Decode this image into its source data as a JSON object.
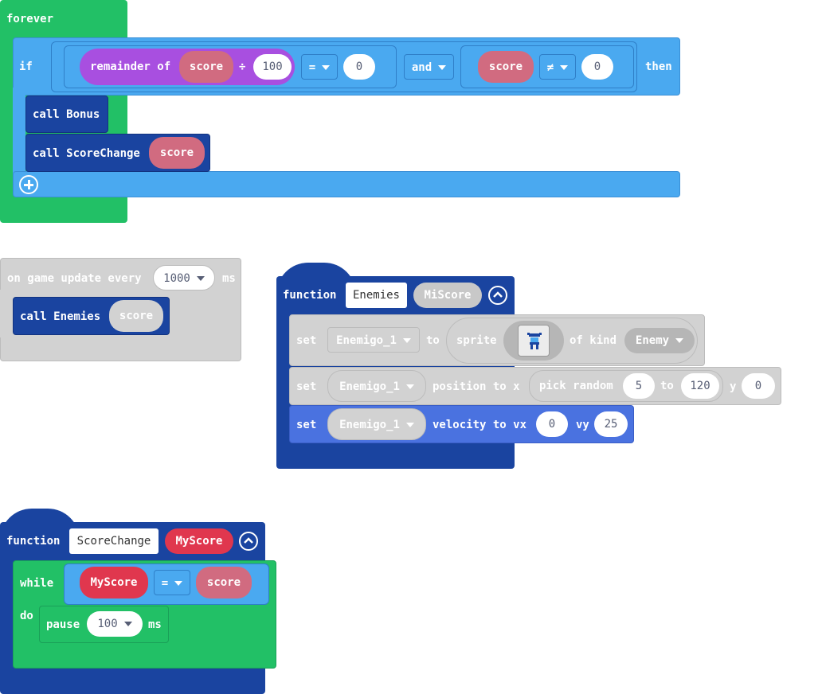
{
  "forever_block": {
    "label": "forever",
    "if_label": "if",
    "remainder_label": "remainder of",
    "score_var_1": "score",
    "divide_symbol": "÷",
    "divisor": "100",
    "eq_op": "=",
    "eq_value": "0",
    "and_label": "and",
    "score_var_2": "score",
    "neq_op": "≠",
    "neq_value": "0",
    "then_label": "then",
    "call_bonus": "call Bonus",
    "call_scorechange": "call ScoreChange",
    "call_scorechange_arg": "score"
  },
  "game_update_block": {
    "label": "on game update every",
    "interval": "1000",
    "unit": "ms",
    "call_enemies": "call Enemies",
    "call_enemies_arg": "score"
  },
  "function_enemies": {
    "label": "function",
    "name": "Enemies",
    "param": "MiScore",
    "set1_label": "set",
    "set1_var": "Enemigo_1",
    "set1_to": "to",
    "set1_sprite": "sprite",
    "set1_of_kind": "of kind",
    "set1_kind": "Enemy",
    "set2_label": "set",
    "set2_var": "Enemigo_1",
    "set2_position": "position to x",
    "set2_pick_random": "pick random",
    "set2_min": "5",
    "set2_to": "to",
    "set2_max": "120",
    "set2_y": "y",
    "set2_y_value": "0",
    "set3_label": "set",
    "set3_var": "Enemigo_1",
    "set3_velocity": "velocity to vx",
    "set3_vx": "0",
    "set3_vy_label": "vy",
    "set3_vy": "25"
  },
  "function_scorechange": {
    "label": "function",
    "name": "ScoreChange",
    "param": "MyScore",
    "while_label": "while",
    "while_left": "MyScore",
    "while_op": "=",
    "while_right": "score",
    "do_label": "do",
    "pause_label": "pause",
    "pause_value": "100",
    "pause_unit": "ms"
  },
  "colors": {
    "loops_green": "#22c066",
    "logic_blue": "#4aa9f0",
    "functions_dark_blue": "#1a44a0",
    "math_purple": "#a84fe0",
    "variable_pink": "#d16b80",
    "param_red": "#e0374e",
    "disabled_gray": "#d2d2d2"
  }
}
